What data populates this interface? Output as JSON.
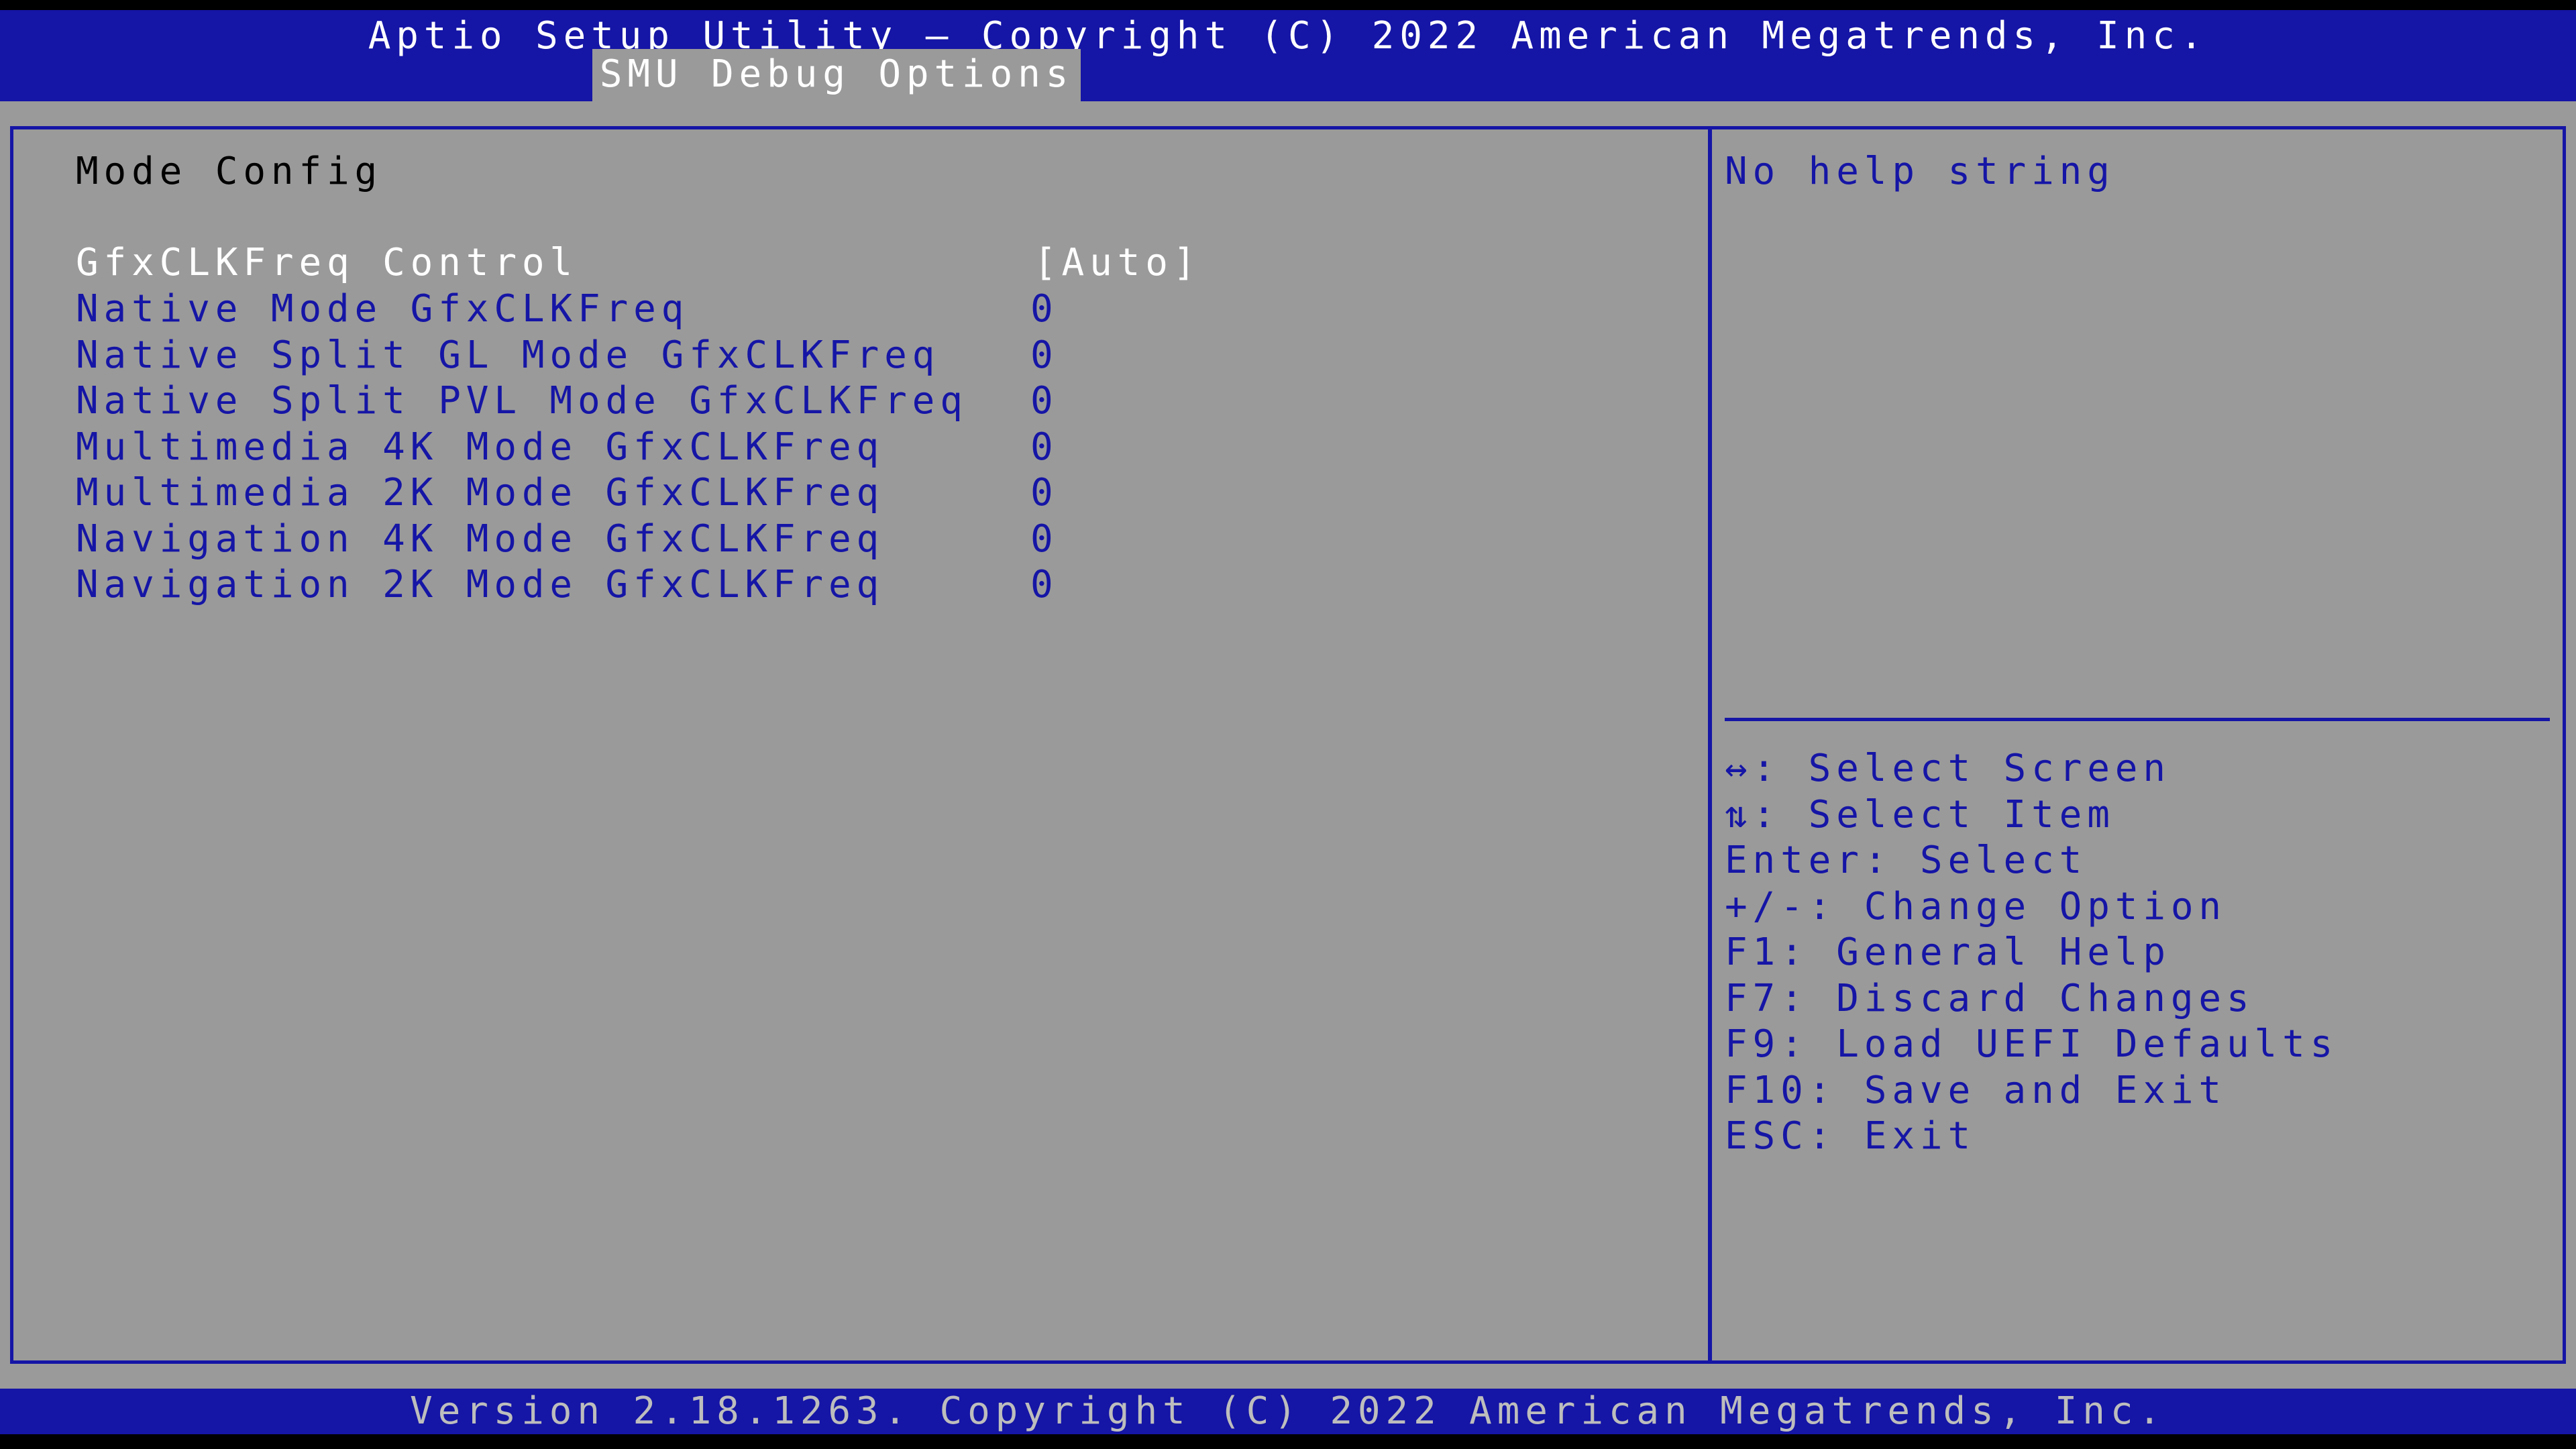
{
  "header": {
    "title": "Aptio Setup Utility – Copyright (C) 2022 American Megatrends, Inc.",
    "active_tab": "SMU Debug Options"
  },
  "main": {
    "section_title": "Mode Config",
    "items": [
      {
        "label": "GfxCLKFreq Control",
        "value": "[Auto]",
        "selected": true
      },
      {
        "label": "Native Mode GfxCLKFreq",
        "value": "0"
      },
      {
        "label": "Native Split GL Mode GfxCLKFreq",
        "value": "0"
      },
      {
        "label": "Native Split PVL Mode GfxCLKFreq",
        "value": "0"
      },
      {
        "label": "Multimedia 4K Mode GfxCLKFreq",
        "value": "0"
      },
      {
        "label": "Multimedia 2K Mode GfxCLKFreq",
        "value": "0"
      },
      {
        "label": "Navigation 4K Mode GfxCLKFreq",
        "value": "0"
      },
      {
        "label": "Navigation 2K Mode GfxCLKFreq",
        "value": "0"
      }
    ]
  },
  "help": {
    "text": "No help string",
    "keys": [
      "↔: Select Screen",
      "⇅: Select Item",
      "Enter: Select",
      "+/-: Change Option",
      "F1: General Help",
      "F7: Discard Changes",
      "F9: Load UEFI Defaults",
      "F10: Save and Exit",
      "ESC: Exit"
    ]
  },
  "footer": {
    "text": "Version 2.18.1263. Copyright (C) 2022 American Megatrends, Inc."
  },
  "colors": {
    "frame_blue": "#1515a6",
    "panel_gray": "#9a9a9a",
    "selected_text": "#ffffff",
    "normal_text": "#1515a6"
  }
}
